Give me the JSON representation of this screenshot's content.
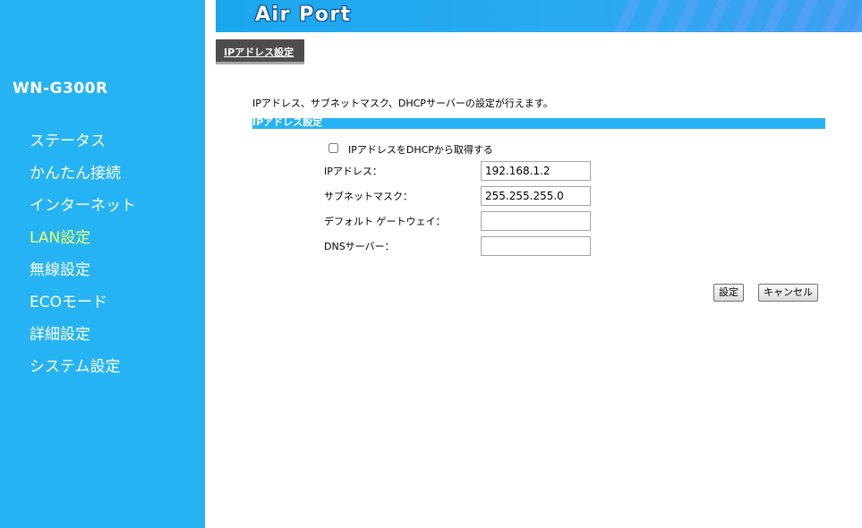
{
  "header": {
    "brand": "Air Port"
  },
  "sidebar": {
    "model": "WN-G300R",
    "items": [
      {
        "label": "ステータス",
        "active": false
      },
      {
        "label": "かんたん接続",
        "active": false
      },
      {
        "label": "インターネット",
        "active": false
      },
      {
        "label": "LAN設定",
        "active": true
      },
      {
        "label": "無線設定",
        "active": false
      },
      {
        "label": "ECOモード",
        "active": false
      },
      {
        "label": "詳細設定",
        "active": false
      },
      {
        "label": "システム設定",
        "active": false
      }
    ]
  },
  "page": {
    "tab_label": "IPアドレス設定",
    "description": "IPアドレス、サブネットマスク、DHCPサーバーの設定が行えます。",
    "section_title": "IPアドレス設定",
    "dhcp_checkbox_label": "IPアドレスをDHCPから取得する",
    "dhcp_checked": false,
    "fields": [
      {
        "label": "IPアドレス：",
        "value": "192.168.1.2"
      },
      {
        "label": "サブネットマスク：",
        "value": "255.255.255.0"
      },
      {
        "label": "デフォルト ゲートウェイ：",
        "value": ""
      },
      {
        "label": "DNSサーバー：",
        "value": ""
      }
    ],
    "buttons": {
      "apply": "設定",
      "cancel": "キャンセル"
    }
  },
  "colors": {
    "sidebar_bg": "#26b3f4",
    "active_nav": "#eaff6a",
    "header_bg": "#1aa7ee",
    "tab_bg": "#4d4d4d"
  }
}
